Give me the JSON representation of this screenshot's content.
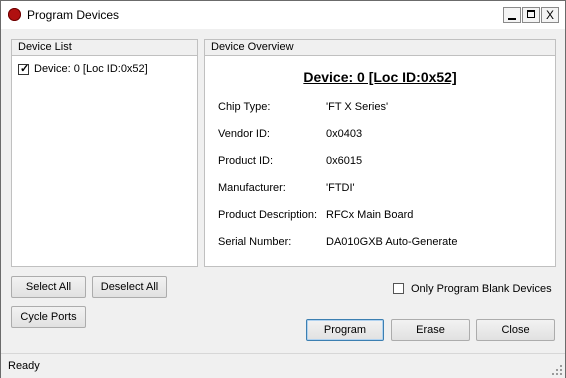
{
  "window": {
    "title": "Program Devices",
    "controls": {
      "minimize": "_",
      "maximize": "□",
      "close": "X"
    }
  },
  "device_list": {
    "header": "Device List",
    "items": [
      {
        "label": "Device: 0 [Loc ID:0x52]",
        "checked": true
      }
    ]
  },
  "overview": {
    "header": "Device Overview",
    "title": "Device: 0 [Loc ID:0x52]",
    "fields": [
      {
        "label": "Chip Type:",
        "value": "'FT X Series'"
      },
      {
        "label": "Vendor ID:",
        "value": "0x0403"
      },
      {
        "label": "Product ID:",
        "value": "0x6015"
      },
      {
        "label": "Manufacturer:",
        "value": "'FTDI'"
      },
      {
        "label": "Product Description:",
        "value": "RFCx Main Board"
      },
      {
        "label": "Serial Number:",
        "value": "DA010GXB Auto-Generate"
      }
    ]
  },
  "buttons": {
    "select_all": "Select All",
    "deselect_all": "Deselect All",
    "cycle_ports": "Cycle Ports",
    "program": "Program",
    "erase": "Erase",
    "close": "Close"
  },
  "options": {
    "only_blank": {
      "label": "Only Program Blank Devices",
      "checked": false
    }
  },
  "status": {
    "text": "Ready"
  },
  "colors": {
    "app_icon": "#b01010",
    "default_button_border": "#3c7fb1"
  }
}
